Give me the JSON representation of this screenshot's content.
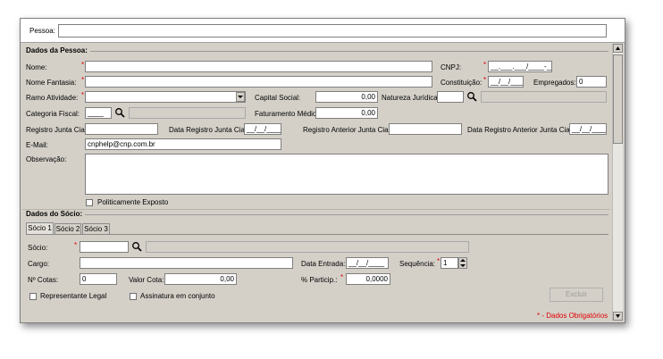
{
  "header": {
    "pessoa_label": "Pessoa:",
    "pessoa_value": ""
  },
  "pessoa_section": {
    "title": "Dados da Pessoa:",
    "nome_label": "Nome:",
    "nome_fantasia_label": "Nome Fantasia:",
    "ramo_label": "Ramo Atividade:",
    "categoria_label": "Categoria Fiscal:",
    "categoria_value": "____",
    "registro_label": "Registro Junta Cial:",
    "data_registro_label": "Data Registro Junta Cial:",
    "data_registro_value": "__/__/____",
    "registro_anterior_label": "Registro Anterior Junta Cial:",
    "data_registro_anterior_label": "Data Registro Anterior Junta Cial:",
    "data_registro_anterior_value": "__/__/____",
    "email_label": "E-Mail:",
    "email_value": "cnphelp@cnp.com.br",
    "observacao_label": "Observação:",
    "cnpj_label": "CNPJ:",
    "cnpj_value": "__.___.___/____-__",
    "constituicao_label": "Constituição:",
    "constituicao_value": "__/__/____",
    "empregados_label": "Empregados:",
    "empregados_value": "0",
    "capital_label": "Capital Social:",
    "capital_value": "0,00",
    "natureza_label": "Natureza Jurídica:",
    "faturamento_label": "Faturamento Médio:",
    "faturamento_value": "0,00",
    "politicamente_label": "Politicamente Exposto"
  },
  "socio_section": {
    "title": "Dados do Sócio:",
    "tabs": [
      "Sócio 1",
      "Sócio 2",
      "Sócio 3"
    ],
    "socio_label": "Sócio:",
    "cargo_label": "Cargo:",
    "cotas_label": "Nº Cotas:",
    "cotas_value": "0",
    "valor_cota_label": "Valor Cota:",
    "valor_cota_value": "0,00",
    "data_entrada_label": "Data Entrada:",
    "data_entrada_value": "__/__/____",
    "sequencia_label": "Sequência:",
    "sequencia_value": "1",
    "particip_label": "% Particip.:",
    "particip_value": "0,0000",
    "representante_label": "Representante Legal",
    "assinatura_label": "Assinatura em conjunto",
    "excluir_label": "Excluir"
  },
  "footer": {
    "required_note": "* - Dados Obrigatórios"
  },
  "colors": {
    "required": "#e00000",
    "panel": "#d4d0c8"
  }
}
